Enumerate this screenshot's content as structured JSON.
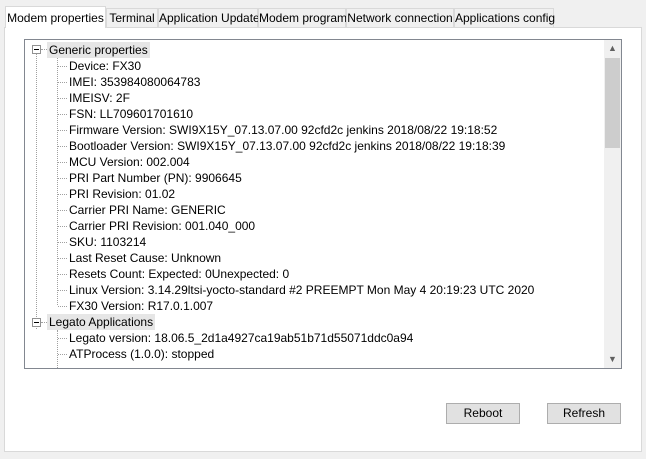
{
  "tabs": [
    {
      "label": "Modem properties",
      "active": true
    },
    {
      "label": "Terminal"
    },
    {
      "label": "Application Update"
    },
    {
      "label": "Modem program"
    },
    {
      "label": "Network connection"
    },
    {
      "label": "Applications config"
    }
  ],
  "tree": {
    "generic": {
      "label": "Generic properties",
      "items": [
        "Device: FX30",
        "IMEI: 353984080064783",
        "IMEISV: 2F",
        "FSN: LL709601701610",
        "Firmware Version: SWI9X15Y_07.13.07.00 92cfd2c jenkins 2018/08/22 19:18:52",
        "Bootloader Version: SWI9X15Y_07.13.07.00 92cfd2c jenkins 2018/08/22 19:18:39",
        "MCU Version: 002.004",
        "PRI Part Number (PN): 9906645",
        "PRI Revision: 01.02",
        "Carrier PRI Name: GENERIC",
        "Carrier PRI Revision: 001.040_000",
        "SKU: 1103214",
        "Last Reset Cause: Unknown",
        "Resets Count: Expected: 0Unexpected: 0",
        "Linux Version: 3.14.29ltsi-yocto-standard #2 PREEMPT Mon May 4 20:19:23 UTC 2020",
        "FX30 Version: R17.0.1.007"
      ]
    },
    "legato": {
      "label": "Legato Applications",
      "items": [
        "Legato version: 18.06.5_2d1a4927ca19ab51b71d55071ddc0a94",
        "ATProcess (1.0.0): stopped"
      ]
    }
  },
  "buttons": {
    "reboot": "Reboot",
    "refresh": "Refresh"
  }
}
